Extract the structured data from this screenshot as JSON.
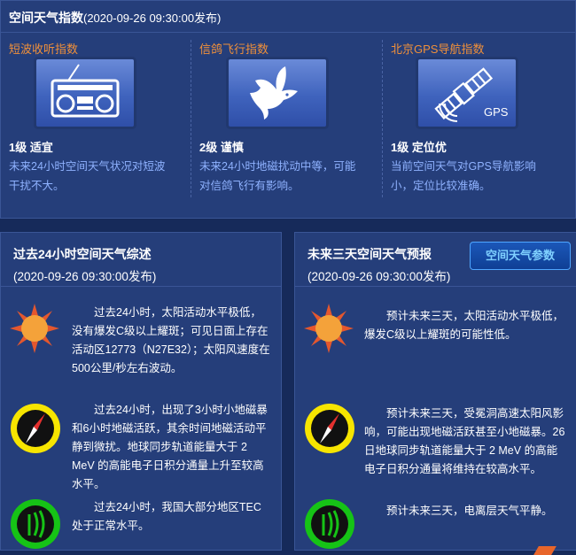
{
  "top": {
    "title": "空间天气指数",
    "stamp": "(2020-09-26 09:30:00发布)",
    "columns": [
      {
        "title": "短波收听指数",
        "icon": "radio-icon",
        "level": "1级 适宜",
        "desc": "未来24小时空间天气状况对短波干扰不大。"
      },
      {
        "title": "信鸽飞行指数",
        "icon": "pigeon-icon",
        "level": "2级 谨慎",
        "desc": "未来24小时地磁扰动中等，可能对信鸽飞行有影响。"
      },
      {
        "title": "北京GPS导航指数",
        "icon": "satellite-icon",
        "icon_text": "GPS",
        "level": "1级 定位优",
        "desc": "当前空间天气对GPS导航影响小，定位比较准确。"
      }
    ]
  },
  "past": {
    "title": "过去24小时空间天气综述",
    "stamp": "(2020-09-26 09:30:00发布)",
    "items": [
      {
        "icon": "sun-icon",
        "text": "过去24小时，太阳活动水平极低，没有爆发C级以上耀斑；可见日面上存在活动区12773（N27E32）；太阳风速度在500公里/秒左右波动。"
      },
      {
        "icon": "compass-icon",
        "text": "过去24小时，出现了3小时小地磁暴和6小时地磁活跃，其余时间地磁活动平静到微扰。地球同步轨道能量大于 2 MeV 的高能电子日积分通量上升至较高水平。"
      },
      {
        "icon": "ionosphere-icon",
        "text": "过去24小时，我国大部分地区TEC处于正常水平。"
      }
    ]
  },
  "forecast": {
    "title": "未来三天空间天气预报",
    "stamp": "(2020-09-26 09:30:00发布)",
    "button_label": "空间天气参数",
    "items": [
      {
        "icon": "sun-icon",
        "text": "预计未来三天，太阳活动水平极低，爆发C级以上耀斑的可能性低。"
      },
      {
        "icon": "compass-icon",
        "text": "预计未来三天，受冕洞高速太阳风影响，可能出现地磁活跃甚至小地磁暴。26日地球同步轨道能量大于 2 MeV 的高能电子日积分通量将维持在较高水平。"
      },
      {
        "icon": "ionosphere-icon",
        "text": "预计未来三天，电离层天气平静。"
      }
    ]
  },
  "colors": {
    "panel": "#253e7a",
    "background": "#162a5a",
    "index_title": "#f0903a",
    "desc_text": "#8fb2ff",
    "button_text": "#7fd0ff"
  }
}
